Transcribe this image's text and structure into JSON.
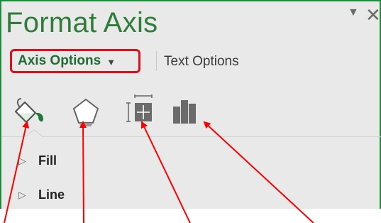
{
  "pane": {
    "title": "Format Axis",
    "dropdown_icon": "triangle-down-icon",
    "close_icon": "close-icon"
  },
  "tabs": {
    "axis_options_label": "Axis Options",
    "text_options_label": "Text Options",
    "active": "Axis Options"
  },
  "icon_row": [
    {
      "name": "fill-and-line-icon",
      "label": "Fill & Line"
    },
    {
      "name": "effects-icon",
      "label": "Effects"
    },
    {
      "name": "size-and-properties-icon",
      "label": "Size & Properties"
    },
    {
      "name": "axis-options-icon",
      "label": "Axis Options"
    }
  ],
  "sections": [
    {
      "label": "Fill",
      "expanded": false
    },
    {
      "label": "Line",
      "expanded": false
    }
  ],
  "colors": {
    "accent_green": "#2e7d3a",
    "highlight_red": "#e01018",
    "pane_bg": "#e9e9e9"
  }
}
